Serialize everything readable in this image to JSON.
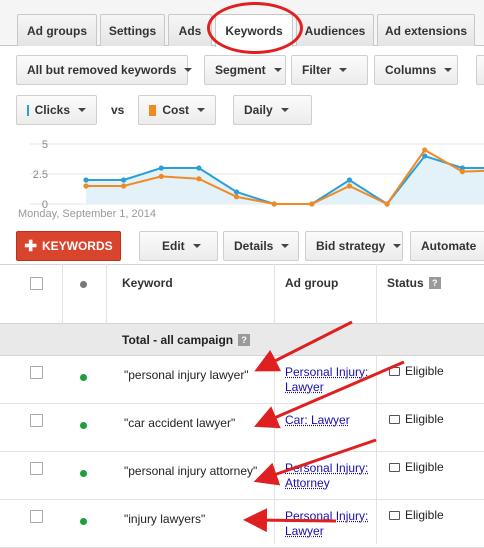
{
  "tabs": [
    {
      "label": "Ad groups"
    },
    {
      "label": "Settings"
    },
    {
      "label": "Ads"
    },
    {
      "label": "Keywords"
    },
    {
      "label": "Audiences"
    },
    {
      "label": "Ad extensions"
    }
  ],
  "active_tab": "Keywords",
  "filters": {
    "view": "All but removed keywords",
    "segment": "Segment",
    "filter": "Filter",
    "columns": "Columns"
  },
  "metrics": {
    "metric1": "Clicks",
    "metric1_color": "#2a9fd8",
    "vs": "vs",
    "metric2": "Cost",
    "metric2_color": "#f08a24",
    "period": "Daily"
  },
  "chart_data": {
    "type": "line",
    "y_ticks": [
      "5",
      "2.5",
      "0"
    ],
    "ylim": [
      0,
      5
    ],
    "start_label": "Monday, September 1, 2014",
    "series": [
      {
        "name": "Clicks",
        "color": "#2a9fd8",
        "values": [
          2,
          2,
          3,
          3,
          1,
          0,
          0,
          2,
          0,
          4,
          3,
          3
        ]
      },
      {
        "name": "Cost",
        "color": "#f08a24",
        "values": [
          1.5,
          1.5,
          2.3,
          2.1,
          0.6,
          0,
          0,
          1.5,
          0,
          4.5,
          2.7,
          2.8
        ]
      }
    ]
  },
  "actions": {
    "add_keywords": "KEYWORDS",
    "edit": "Edit",
    "details": "Details",
    "bid_strategy": "Bid strategy",
    "automate": "Automate"
  },
  "table": {
    "headers": {
      "keyword": "Keyword",
      "ad_group": "Ad group",
      "status": "Status"
    },
    "total_label": "Total - all campaign",
    "rows": [
      {
        "keyword": "\"personal injury lawyer\"",
        "ad_group": "Personal Injury: Lawyer",
        "status": "Eligible"
      },
      {
        "keyword": "\"car accident lawyer\"",
        "ad_group": "Car: Lawyer",
        "status": "Eligible"
      },
      {
        "keyword": "\"personal injury attorney\"",
        "ad_group": "Personal Injury: Attorney",
        "status": "Eligible"
      },
      {
        "keyword": "\"injury lawyers\"",
        "ad_group": "Personal Injury: Lawyer",
        "status": "Eligible"
      }
    ],
    "status_dot_color": "#1e9e3e"
  }
}
